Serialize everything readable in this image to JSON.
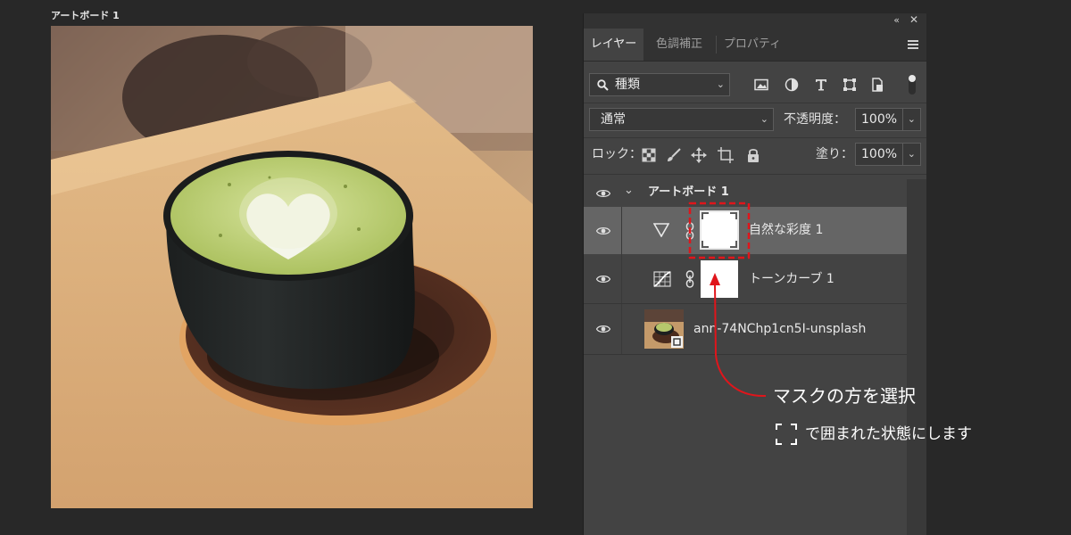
{
  "artboard": {
    "label": "アートボード 1"
  },
  "panel": {
    "collapse_icon": "double-chevron-left-icon",
    "close_icon": "close-icon",
    "tabs": [
      {
        "label": "レイヤー",
        "active": true
      },
      {
        "label": "色調補正",
        "active": false
      },
      {
        "label": "プロパティ",
        "active": false
      }
    ],
    "menu_icon": "hamburger-menu-icon",
    "filter": {
      "search_icon": "search-icon",
      "kind_label": "種類",
      "filter_icons": [
        "image-filter-icon",
        "adjustment-filter-icon",
        "type-filter-icon",
        "shape-filter-icon",
        "smart-object-filter-icon"
      ]
    },
    "blend": {
      "mode": "通常",
      "opacity_label": "不透明度：",
      "opacity_value": "100%"
    },
    "lock": {
      "label": "ロック：",
      "icons": [
        "lock-transparent-icon",
        "lock-paint-icon",
        "lock-position-icon",
        "lock-artboard-icon",
        "lock-all-icon"
      ],
      "fill_label": "塗り：",
      "fill_value": "100%"
    },
    "layers": [
      {
        "name": "アートボード 1",
        "type": "artboard-group",
        "visible": true
      },
      {
        "name": "自然な彩度 1",
        "type": "vibrance-adjustment",
        "visible": true,
        "selected": true
      },
      {
        "name": "トーンカーブ 1",
        "type": "curves-adjustment",
        "visible": true
      },
      {
        "name": "ann-74NChp1cn5I-unsplash",
        "type": "smart-object",
        "visible": true
      }
    ]
  },
  "annotation": {
    "main": "マスクの方を選択",
    "sub": "で囲まれた状態にします",
    "color": "#e0151b"
  },
  "colors": {
    "background": "#282828",
    "panel": "#434343",
    "selected_layer": "#656565",
    "accent_red": "#e0151b"
  }
}
